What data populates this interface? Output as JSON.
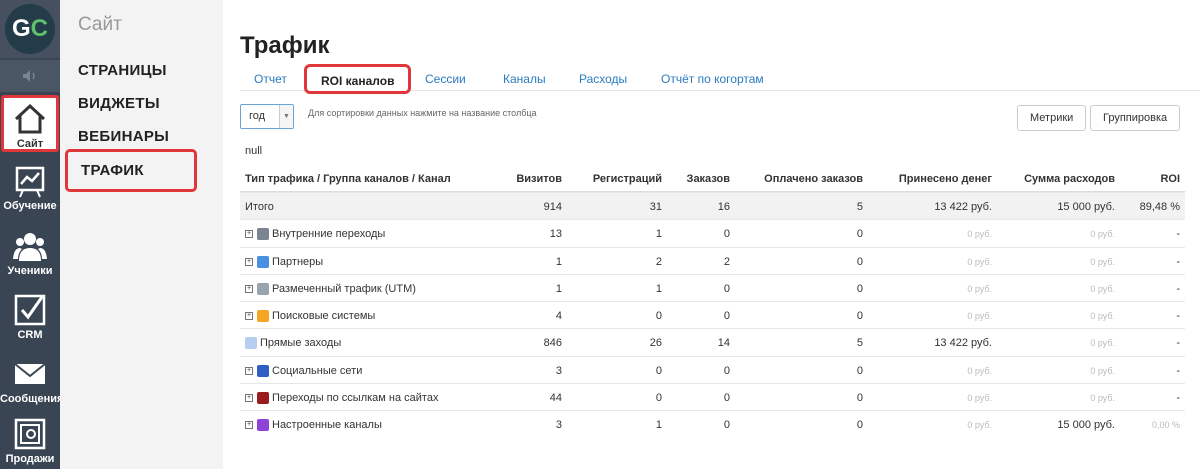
{
  "rail": {
    "logo": {
      "g": "G",
      "c": "C"
    },
    "items": [
      {
        "label": "Сайт",
        "icon": "home-icon"
      },
      {
        "label": "Обучение",
        "icon": "chart-board-icon"
      },
      {
        "label": "Ученики",
        "icon": "users-icon"
      },
      {
        "label": "CRM",
        "icon": "checkbox-icon"
      },
      {
        "label": "Сообщения",
        "icon": "envelope-icon"
      },
      {
        "label": "Продажи",
        "icon": "safe-icon"
      }
    ]
  },
  "sidebar": {
    "title": "Сайт",
    "items": [
      {
        "label": "СТРАНИЦЫ"
      },
      {
        "label": "ВИДЖЕТЫ"
      },
      {
        "label": "ВЕБИНАРЫ"
      },
      {
        "label": "ТРАФИК"
      }
    ]
  },
  "main": {
    "title": "Трафик",
    "tabs": [
      {
        "label": "Отчет"
      },
      {
        "label": "ROI каналов"
      },
      {
        "label": "Сессии"
      },
      {
        "label": "Каналы"
      },
      {
        "label": "Расходы"
      },
      {
        "label": "Отчёт по когортам"
      }
    ],
    "period": {
      "value": "год"
    },
    "hint": "Для сортировки данных нажмите на название столбца",
    "buttons": {
      "metrics": "Метрики",
      "grouping": "Группировка"
    },
    "null_label": "null"
  },
  "table": {
    "columns": [
      "Тип трафика / Группа каналов / Канал",
      "Визитов",
      "Регистраций",
      "Заказов",
      "Оплачено заказов",
      "Принесено денег",
      "Сумма расходов",
      "ROI"
    ],
    "total": {
      "name": "Итого",
      "visits": "914",
      "regs": "31",
      "orders": "16",
      "paid": "5",
      "money": "13 422 руб.",
      "costs": "15 000 руб.",
      "roi": "89,48 %"
    },
    "rows": [
      {
        "expand": "+",
        "name": "Внутренние переходы",
        "icon_color": "#7a8591",
        "visits": "13",
        "regs": "1",
        "orders": "0",
        "paid": "0",
        "money": "0 руб.",
        "costs": "0 руб.",
        "roi": "-"
      },
      {
        "expand": "+",
        "name": "Партнеры",
        "icon_color": "#4a90e2",
        "visits": "1",
        "regs": "2",
        "orders": "2",
        "paid": "0",
        "money": "0 руб.",
        "costs": "0 руб.",
        "roi": "-"
      },
      {
        "expand": "+",
        "name": "Размеченный трафик (UTM)",
        "icon_color": "#9aa4ad",
        "visits": "1",
        "regs": "1",
        "orders": "0",
        "paid": "0",
        "money": "0 руб.",
        "costs": "0 руб.",
        "roi": "-"
      },
      {
        "expand": "+",
        "name": "Поисковые системы",
        "icon_color": "#f5a623",
        "visits": "4",
        "regs": "0",
        "orders": "0",
        "paid": "0",
        "money": "0 руб.",
        "costs": "0 руб.",
        "roi": "-"
      },
      {
        "expand": "",
        "name": "Прямые заходы",
        "icon_color": "#b8cef0",
        "visits": "846",
        "regs": "26",
        "orders": "14",
        "paid": "5",
        "money": "13 422 руб.",
        "costs": "0 руб.",
        "roi": "-"
      },
      {
        "expand": "+",
        "name": "Социальные сети",
        "icon_color": "#2f5fc4",
        "visits": "3",
        "regs": "0",
        "orders": "0",
        "paid": "0",
        "money": "0 руб.",
        "costs": "0 руб.",
        "roi": "-"
      },
      {
        "expand": "+",
        "name": "Переходы по ссылкам на сайтах",
        "icon_color": "#9b1c1c",
        "visits": "44",
        "regs": "0",
        "orders": "0",
        "paid": "0",
        "money": "0 руб.",
        "costs": "0 руб.",
        "roi": "-"
      },
      {
        "expand": "+",
        "name": "Настроенные каналы",
        "icon_color": "#8e44d6",
        "visits": "3",
        "regs": "1",
        "orders": "0",
        "paid": "0",
        "money": "0 руб.",
        "costs": "15 000 руб.",
        "roi": "0,00 %"
      }
    ]
  }
}
